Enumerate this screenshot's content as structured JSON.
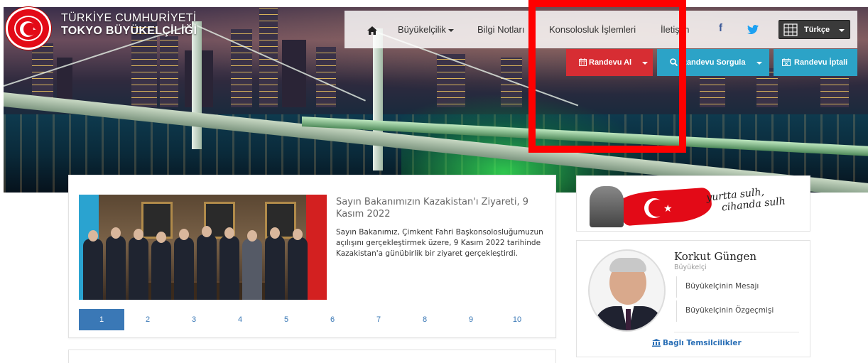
{
  "brand": {
    "line1": "TÜRKİYE CUMHURİYETİ",
    "line2": "TOKYO BÜYÜKELÇİLİĞİ",
    "logo_icon": "turkish-crescent-star-seal-icon"
  },
  "nav": {
    "home_icon": "home-icon",
    "items": [
      {
        "label": "Büyükelçilik",
        "has_dropdown": true
      },
      {
        "label": "Bilgi Notları",
        "has_dropdown": false
      },
      {
        "label": "Konsolosluk İşlemleri",
        "has_dropdown": false
      },
      {
        "label": "İletişim",
        "has_dropdown": false
      }
    ],
    "facebook_label": "f",
    "twitter_icon": "twitter-icon",
    "language_label": "Türkçe",
    "globe_icon": "globe-icon"
  },
  "appointments": {
    "book_label": "Randevu Al",
    "query_label": "Randevu Sorgula",
    "cancel_label": "Randevu İptali",
    "book_color": "#d72d33",
    "secondary_color": "#2ca3c7"
  },
  "news": {
    "title": "Sayın Bakanımızın Kazakistan'ı Ziyareti, 9 Kasım 2022",
    "body": "Sayın Bakanımız, Çimkent Fahri Başkonsolosluğumuzun açılışını gerçekleştirmek üzere, 9 Kasım 2022 tarihinde Kazakistan'a günübirlik bir ziyaret gerçekleştirdi.",
    "pages": [
      "1",
      "2",
      "3",
      "4",
      "5",
      "6",
      "7",
      "8",
      "9",
      "10"
    ],
    "active_page": "1",
    "accent_color": "#3a78b6"
  },
  "banner": {
    "quote_line1": "yurtta sulh,",
    "quote_line2": "cihanda sulh"
  },
  "ambassador": {
    "name": "Korkut Güngen",
    "role": "Büyükelçi",
    "links": [
      "Büyükelçinin Mesajı",
      "Büyükelçinin Özgeçmişi"
    ],
    "missions_label": "Bağlı Temsilcilikler",
    "missions_icon": "institution-icon"
  },
  "highlight_color": "#ff0000"
}
